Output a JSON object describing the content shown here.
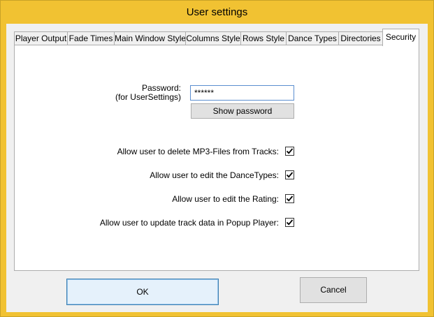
{
  "window": {
    "title": "User settings"
  },
  "tabs": [
    {
      "label": "Player Output"
    },
    {
      "label": "Fade Times"
    },
    {
      "label": "Main Window Style"
    },
    {
      "label": "Columns Style"
    },
    {
      "label": "Rows Style"
    },
    {
      "label": "Dance Types"
    },
    {
      "label": "Directories"
    },
    {
      "label": "Security",
      "active": true
    }
  ],
  "security": {
    "password_label_line1": "Password:",
    "password_label_line2": "(for UserSettings)",
    "password_value": "******",
    "show_password_label": "Show password",
    "options": [
      {
        "label": "Allow user to delete MP3-Files from Tracks:",
        "checked": true
      },
      {
        "label": "Allow user to edit the DanceTypes:",
        "checked": true
      },
      {
        "label": "Allow user to edit the Rating:",
        "checked": true
      },
      {
        "label": "Allow user to update track data in Popup Player:",
        "checked": true
      }
    ]
  },
  "buttons": {
    "ok_label": "OK",
    "cancel_label": "Cancel"
  },
  "colors": {
    "titlebar": "#f1c232",
    "focus_border": "#3c7fb1"
  }
}
